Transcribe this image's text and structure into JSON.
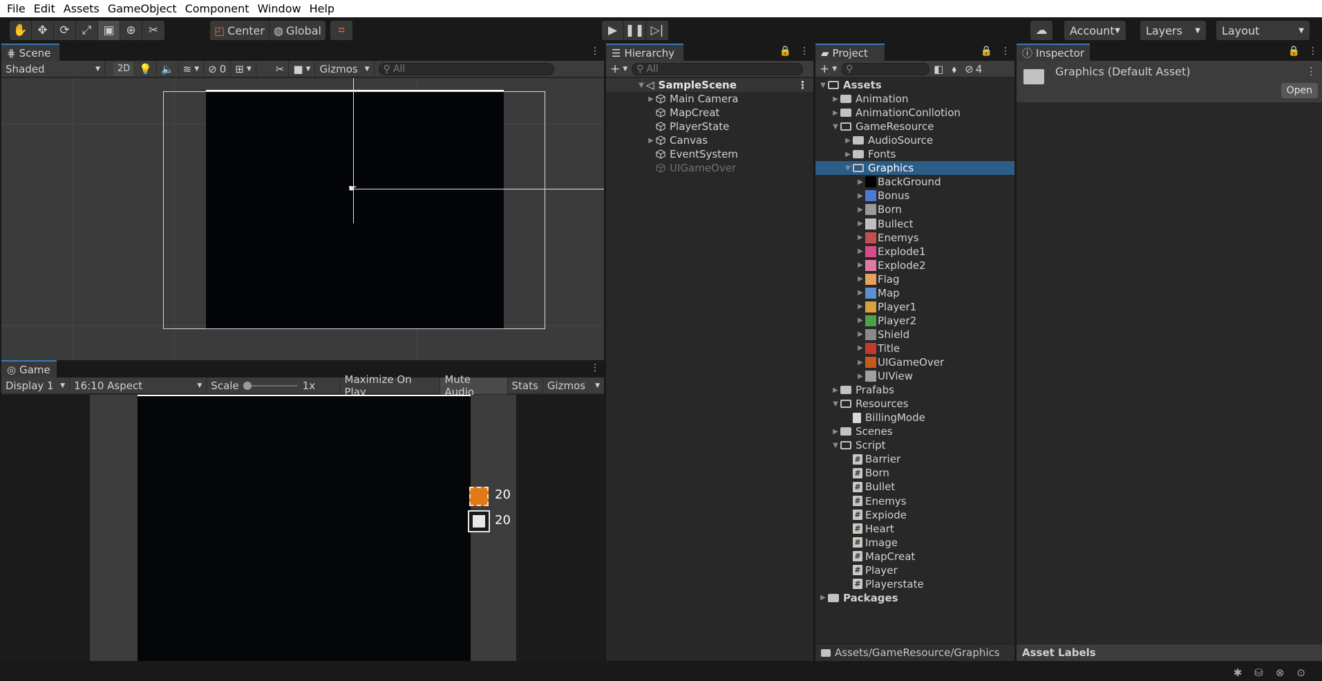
{
  "menu": [
    "File",
    "Edit",
    "Assets",
    "GameObject",
    "Component",
    "Window",
    "Help"
  ],
  "toolbar": {
    "pivot_label": "Center",
    "space_label": "Global",
    "account_label": "Account",
    "layers_label": "Layers",
    "layout_label": "Layout"
  },
  "scene": {
    "tab_label": "Scene",
    "shading_mode": "Shaded",
    "mode_2d": "2D",
    "hidden_count": "0",
    "gizmos_label": "Gizmos",
    "search_placeholder": "All"
  },
  "game": {
    "tab_label": "Game",
    "display": "Display 1",
    "aspect": "16:10 Aspect",
    "scale_label": "Scale",
    "scale_value": "1x",
    "maximize_label": "Maximize On Play",
    "mute_label": "Mute Audio",
    "stats_label": "Stats",
    "gizmos_label": "Gizmos",
    "hud": [
      {
        "icon": "enemy-tank-icon",
        "value": "20"
      },
      {
        "icon": "player-tank-icon",
        "value": "20"
      }
    ]
  },
  "hierarchy": {
    "tab_label": "Hierarchy",
    "search_placeholder": "All",
    "scene_name": "SampleScene",
    "items": [
      {
        "label": "Main Camera",
        "expandable": true,
        "disabled": false
      },
      {
        "label": "MapCreat",
        "expandable": false,
        "disabled": false
      },
      {
        "label": "PlayerState",
        "expandable": false,
        "disabled": false
      },
      {
        "label": "Canvas",
        "expandable": true,
        "disabled": false
      },
      {
        "label": "EventSystem",
        "expandable": false,
        "disabled": false
      },
      {
        "label": "UIGameOver",
        "expandable": false,
        "disabled": true
      }
    ]
  },
  "project": {
    "tab_label": "Project",
    "hidden_packages_count": "4",
    "footer_path": "Assets/GameResource/Graphics",
    "tree": [
      {
        "label": "Assets",
        "depth": 0,
        "type": "folder-open",
        "expanded": true,
        "bold": true
      },
      {
        "label": "Animation",
        "depth": 1,
        "type": "folder",
        "expanded": false
      },
      {
        "label": "AnimationConllotion",
        "depth": 1,
        "type": "folder",
        "expanded": false
      },
      {
        "label": "GameResource",
        "depth": 1,
        "type": "folder-open",
        "expanded": true
      },
      {
        "label": "AudioSource",
        "depth": 2,
        "type": "folder",
        "expanded": false
      },
      {
        "label": "Fonts",
        "depth": 2,
        "type": "folder",
        "expanded": false
      },
      {
        "label": "Graphics",
        "depth": 2,
        "type": "folder-open",
        "expanded": true,
        "selected": true
      },
      {
        "label": "BackGround",
        "depth": 3,
        "type": "sprite",
        "thumb": "#000000"
      },
      {
        "label": "Bonus",
        "depth": 3,
        "type": "sprite",
        "thumb": "#4a7bd0"
      },
      {
        "label": "Born",
        "depth": 3,
        "type": "sprite",
        "thumb": "#9a9a9a"
      },
      {
        "label": "Bullect",
        "depth": 3,
        "type": "sprite",
        "thumb": "#bfbfbf"
      },
      {
        "label": "Enemys",
        "depth": 3,
        "type": "sprite",
        "thumb": "#c0504d"
      },
      {
        "label": "Explode1",
        "depth": 3,
        "type": "sprite",
        "thumb": "#d94a8c"
      },
      {
        "label": "Explode2",
        "depth": 3,
        "type": "sprite",
        "thumb": "#e07aa0"
      },
      {
        "label": "Flag",
        "depth": 3,
        "type": "sprite",
        "thumb": "#e8a060"
      },
      {
        "label": "Map",
        "depth": 3,
        "type": "sprite",
        "thumb": "#5a8fd0"
      },
      {
        "label": "Player1",
        "depth": 3,
        "type": "sprite",
        "thumb": "#d9a13a"
      },
      {
        "label": "Player2",
        "depth": 3,
        "type": "sprite",
        "thumb": "#4fa04a"
      },
      {
        "label": "Shield",
        "depth": 3,
        "type": "sprite",
        "thumb": "#8a8a8a"
      },
      {
        "label": "Title",
        "depth": 3,
        "type": "sprite",
        "thumb": "#c23b2a"
      },
      {
        "label": "UIGameOver",
        "depth": 3,
        "type": "sprite",
        "thumb": "#c8581e"
      },
      {
        "label": "UIView",
        "depth": 3,
        "type": "sprite",
        "thumb": "#a0a0a0"
      },
      {
        "label": "Prafabs",
        "depth": 1,
        "type": "folder",
        "expanded": false
      },
      {
        "label": "Resources",
        "depth": 1,
        "type": "folder-open",
        "expanded": true
      },
      {
        "label": "BillingMode",
        "depth": 2,
        "type": "doc"
      },
      {
        "label": "Scenes",
        "depth": 1,
        "type": "folder",
        "expanded": false
      },
      {
        "label": "Script",
        "depth": 1,
        "type": "folder-open",
        "expanded": true
      },
      {
        "label": "Barrier",
        "depth": 2,
        "type": "script"
      },
      {
        "label": "Born",
        "depth": 2,
        "type": "script"
      },
      {
        "label": "Bullet",
        "depth": 2,
        "type": "script"
      },
      {
        "label": "Enemys",
        "depth": 2,
        "type": "script"
      },
      {
        "label": "Expiode",
        "depth": 2,
        "type": "script"
      },
      {
        "label": "Heart",
        "depth": 2,
        "type": "script"
      },
      {
        "label": "Image",
        "depth": 2,
        "type": "script"
      },
      {
        "label": "MapCreat",
        "depth": 2,
        "type": "script"
      },
      {
        "label": "Player",
        "depth": 2,
        "type": "script"
      },
      {
        "label": "Playerstate",
        "depth": 2,
        "type": "script"
      },
      {
        "label": "Packages",
        "depth": 0,
        "type": "folder",
        "expanded": false,
        "bold": true
      }
    ]
  },
  "inspector": {
    "tab_label": "Inspector",
    "asset_title": "Graphics (Default Asset)",
    "open_button": "Open",
    "asset_labels": "Asset Labels"
  },
  "colors": {
    "selection": "#2c5d87",
    "tab_accent": "#3a79bb",
    "panel_bg": "#282828"
  }
}
